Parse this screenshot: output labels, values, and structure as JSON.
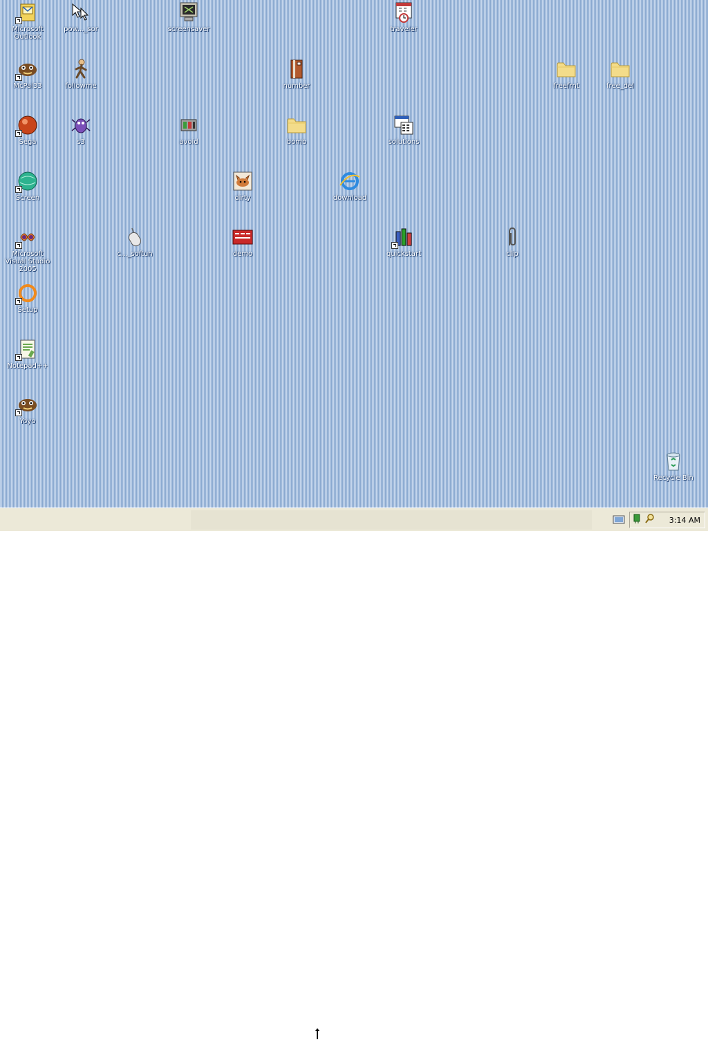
{
  "desktop": {
    "icons": [
      {
        "label": "Microsoft Outlook",
        "icon": "outlook-icon"
      },
      {
        "label": "pow..._sor",
        "icon": "cursor-icon"
      },
      {
        "label": "screensaver",
        "icon": "monitor-icon"
      },
      {
        "label": "traveler",
        "icon": "calendar-clock-icon"
      },
      {
        "label": "McPal33",
        "icon": "mcpal-icon"
      },
      {
        "label": "followme",
        "icon": "walker-icon"
      },
      {
        "label": "number",
        "icon": "book-icon"
      },
      {
        "label": "freefrnt",
        "icon": "folder-icon"
      },
      {
        "label": "free_del",
        "icon": "folder-icon"
      },
      {
        "label": "Sega",
        "icon": "ball-icon"
      },
      {
        "label": "s3",
        "icon": "bug-icon"
      },
      {
        "label": "avoid",
        "icon": "tool-icon"
      },
      {
        "label": "bomb",
        "icon": "folder-icon"
      },
      {
        "label": "solutions",
        "icon": "calc-window-icon"
      },
      {
        "label": "Screen",
        "icon": "globe-icon"
      },
      {
        "label": "dirty",
        "icon": "cat-icon"
      },
      {
        "label": "download",
        "icon": "internet-explorer-icon"
      },
      {
        "label": "Microsoft Visual Studio 2005",
        "icon": "visual-studio-icon"
      },
      {
        "label": "c..._softun",
        "icon": "mouse-icon"
      },
      {
        "label": "demo",
        "icon": "banner-icon"
      },
      {
        "label": "quickstart",
        "icon": "tools-icon"
      },
      {
        "label": "clip",
        "icon": "paperclip-icon"
      },
      {
        "label": "Setup",
        "icon": "ring-icon"
      },
      {
        "label": "Notepad++",
        "icon": "notepad-icon"
      },
      {
        "label": "Yoyo",
        "icon": "yoyo-icon"
      },
      {
        "label": "Recycle Bin",
        "icon": "recycle-bin-icon"
      }
    ]
  },
  "taskbar": {
    "clock": "3:14 AM",
    "tray_icons": [
      "network-icon",
      "search-icon"
    ],
    "quick_icon": "desktop-icon"
  }
}
